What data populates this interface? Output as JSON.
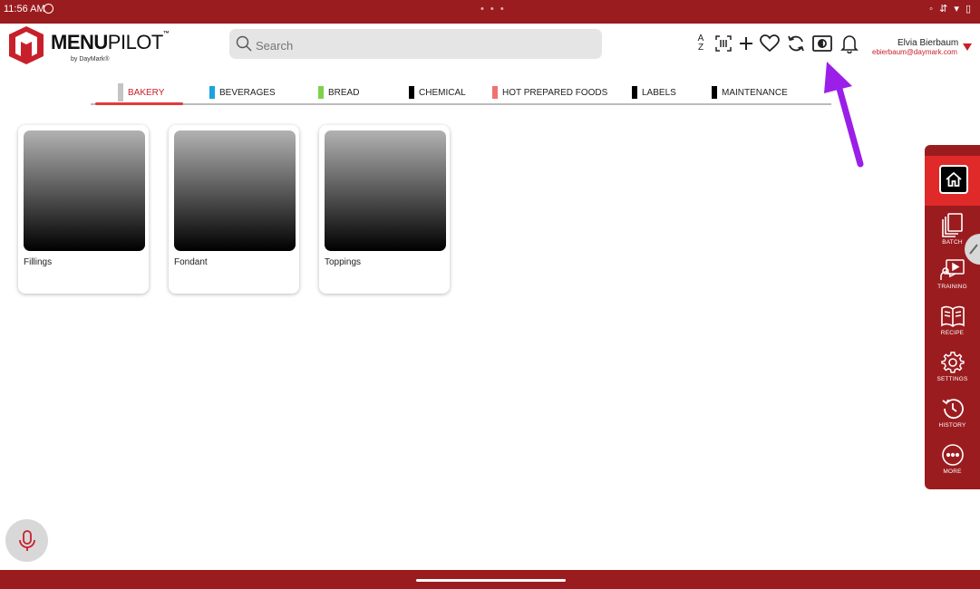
{
  "status_bar": {
    "time": "11:56 AM",
    "indicators": "◦ ⇵ ▾ ▯",
    "overflow": "• • •"
  },
  "brand": {
    "name_bold": "MENU",
    "name_regular": "PILOT",
    "trademark": "™",
    "byline": "by DayMark®"
  },
  "search": {
    "placeholder": "Search",
    "value": ""
  },
  "toolbar": {
    "icons": [
      "sort-az-icon",
      "scan-icon",
      "add-icon",
      "favorite-icon",
      "sync-icon",
      "display-mode-icon",
      "notification-icon"
    ],
    "sort_label_top": "A",
    "sort_label_bottom": "Z"
  },
  "user": {
    "name": "Elvia Bierbaum",
    "email": "ebierbaum@daymark.com"
  },
  "tabs": [
    {
      "label": "BAKERY",
      "color": "#c4c4c4",
      "active": true
    },
    {
      "label": "BEVERAGES",
      "color": "#1aa3e0"
    },
    {
      "label": "BREAD",
      "color": "#7ed14a"
    },
    {
      "label": "CHEMICAL",
      "color": "#000000"
    },
    {
      "label": "HOT PREPARED FOODS",
      "color": "#f07070"
    },
    {
      "label": "LABELS",
      "color": "#000000"
    },
    {
      "label": "MAINTENANCE",
      "color": "#000000"
    }
  ],
  "cards": [
    {
      "label": "Fillings"
    },
    {
      "label": "Fondant"
    },
    {
      "label": "Toppings"
    }
  ],
  "side_menu": {
    "items": [
      {
        "label": "BATCH",
        "icon": "batch-icon"
      },
      {
        "label": "TRAINING",
        "icon": "training-icon"
      },
      {
        "label": "RECIPE",
        "icon": "recipe-icon"
      },
      {
        "label": "SETTINGS",
        "icon": "settings-icon"
      },
      {
        "label": "HISTORY",
        "icon": "history-icon"
      },
      {
        "label": "MORE",
        "icon": "more-icon"
      }
    ]
  },
  "colors": {
    "brand_red": "#9b1c1f",
    "accent_red": "#e02a2a",
    "annotation_purple": "#9b1fe8"
  }
}
